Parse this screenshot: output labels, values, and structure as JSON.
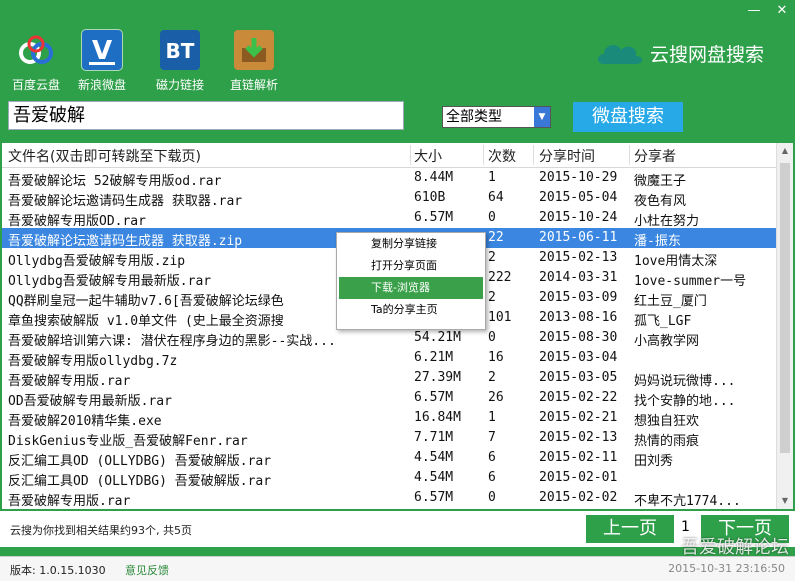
{
  "window": {
    "min": "—",
    "close": "✕"
  },
  "toolbar": [
    {
      "label": "百度云盘",
      "icon": "baidu-cloud-icon"
    },
    {
      "label": "新浪微盘",
      "icon": "sina-vdisk-icon"
    },
    {
      "label": "磁力链接",
      "icon": "magnet-bt-icon"
    },
    {
      "label": "直链解析",
      "icon": "direct-link-icon"
    }
  ],
  "brand": {
    "name": "云搜网盘搜索"
  },
  "search": {
    "query": "吾爱破解",
    "type": "全部类型",
    "button": "微盘搜索"
  },
  "columns": [
    "文件名(双击即可转跳至下载页)",
    "大小",
    "次数",
    "分享时间",
    "分享者"
  ],
  "rows": [
    {
      "name": "吾爱破解论坛 52破解专用版od.rar",
      "size": "8.44M",
      "count": "1",
      "date": "2015-10-29",
      "sharer": "微魔王子"
    },
    {
      "name": "吾爱破解论坛邀请码生成器 获取器.rar",
      "size": "610B",
      "count": "64",
      "date": "2015-05-04",
      "sharer": "夜色有风"
    },
    {
      "name": "吾爱破解专用版OD.rar",
      "size": "6.57M",
      "count": "0",
      "date": "2015-10-24",
      "sharer": "小杜在努力"
    },
    {
      "name": "吾爱破解论坛邀请码生成器 获取器.zip",
      "size": "",
      "count": "22",
      "date": "2015-06-11",
      "sharer": "潘-振东"
    },
    {
      "name": "Ollydbg吾爱破解专用版.zip",
      "size": "",
      "count": "2",
      "date": "2015-02-13",
      "sharer": "1ove用情太深"
    },
    {
      "name": "Ollydbg吾爱破解专用最新版.rar",
      "size": "",
      "count": "222",
      "date": "2014-03-31",
      "sharer": "1ove-summer一号"
    },
    {
      "name": "QQ群刷皇冠一起牛辅助v7.6[吾爱破解论坛绿色",
      "size": "",
      "count": "2",
      "date": "2015-03-09",
      "sharer": "红土豆_厦门"
    },
    {
      "name": "章鱼搜索破解版 v1.0单文件 (史上最全资源搜",
      "size": "",
      "count": "101",
      "date": "2013-08-16",
      "sharer": "孤飞_LGF"
    },
    {
      "name": "吾爱破解培训第六课: 潜伏在程序身边的黑影--实战...",
      "size": "54.21M",
      "count": "0",
      "date": "2015-08-30",
      "sharer": "小高教学网"
    },
    {
      "name": "吾爱破解专用版ollydbg.7z",
      "size": "6.21M",
      "count": "16",
      "date": "2015-03-04",
      "sharer": ""
    },
    {
      "name": "吾爱破解专用版.rar",
      "size": "27.39M",
      "count": "2",
      "date": "2015-03-05",
      "sharer": "妈妈说玩微博..."
    },
    {
      "name": "OD吾爱破解专用最新版.rar",
      "size": "6.57M",
      "count": "26",
      "date": "2015-02-22",
      "sharer": "找个安静的地..."
    },
    {
      "name": "吾爱破解2010精华集.exe",
      "size": "16.84M",
      "count": "1",
      "date": "2015-02-21",
      "sharer": "想独自狂欢"
    },
    {
      "name": "DiskGenius专业版_吾爱破解Fenr.rar",
      "size": "7.71M",
      "count": "7",
      "date": "2015-02-13",
      "sharer": "热情的雨痕"
    },
    {
      "name": "反汇编工具OD (OLLYDBG) 吾爱破解版.rar",
      "size": "4.54M",
      "count": "6",
      "date": "2015-02-11",
      "sharer": "田刘秀"
    },
    {
      "name": "反汇编工具OD (OLLYDBG) 吾爱破解版.rar",
      "size": "4.54M",
      "count": "6",
      "date": "2015-02-01",
      "sharer": ""
    },
    {
      "name": "吾爱破解专用版.rar",
      "size": "6.57M",
      "count": "0",
      "date": "2015-02-02",
      "sharer": "不卑不亢1774..."
    }
  ],
  "selected_row": 3,
  "context_menu": [
    "复制分享链接",
    "打开分享页面",
    "下载-浏览器",
    "Ta的分享主页"
  ],
  "context_highlight": 2,
  "status": {
    "found": "云搜为你找到相关结果约93个, 共5页",
    "prev": "上一页",
    "page": "1",
    "next": "下一页"
  },
  "footer": {
    "version": "版本: 1.0.15.1030",
    "feedback": "意见反馈",
    "timestamp": "2015-10-31 23:16:50"
  },
  "watermark": "吾爱破解论坛",
  "colors": {
    "green": "#2fa04a",
    "blue_button": "#27a9e8",
    "select": "#3a86e0"
  }
}
